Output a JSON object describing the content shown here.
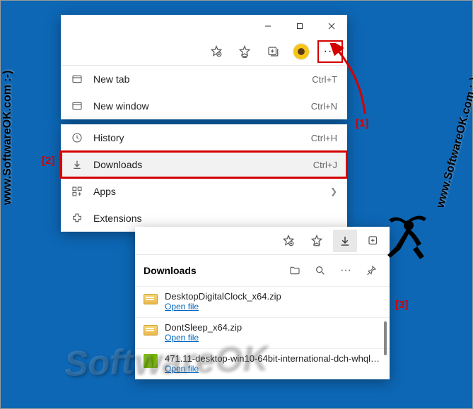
{
  "watermark": "SoftwareOK",
  "side_label": "www.SoftwareOK.com :-)",
  "annotations": {
    "a1": "[1]",
    "a2": "[2]",
    "a3": "[3]"
  },
  "titlebar": {
    "min": "—",
    "max": "▢",
    "close": "✕"
  },
  "toolbar": {
    "more": "···"
  },
  "menu1": {
    "newtab_label": "New tab",
    "newtab_shortcut": "Ctrl+T",
    "newwin_label": "New window",
    "newwin_shortcut": "Ctrl+N"
  },
  "menu2": {
    "history_label": "History",
    "history_shortcut": "Ctrl+H",
    "downloads_label": "Downloads",
    "downloads_shortcut": "Ctrl+J",
    "apps_label": "Apps",
    "extensions_label": "Extensions"
  },
  "downloads_panel": {
    "title": "Downloads",
    "items": [
      {
        "name": "DesktopDigitalClock_x64.zip",
        "action": "Open file"
      },
      {
        "name": "DontSleep_x64.zip",
        "action": "Open file"
      },
      {
        "name": "471.11-desktop-win10-64bit-international-dch-whql.e...",
        "action": "Open file"
      }
    ]
  }
}
